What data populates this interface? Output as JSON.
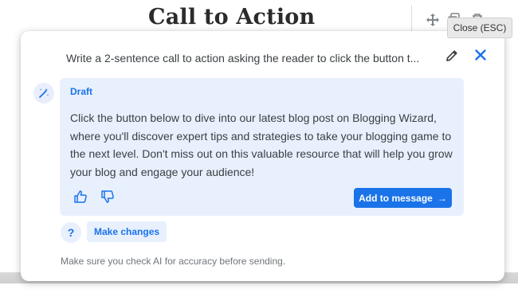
{
  "editor": {
    "title": "Call to Action",
    "toolbar_icons": [
      "move-icon",
      "copy-icon",
      "delete-icon"
    ]
  },
  "tooltip": {
    "text": "Close (ESC)"
  },
  "dialog": {
    "prompt": "Write a 2-sentence call to action asking the reader to click the button t...",
    "draft": {
      "label": "Draft",
      "body": "Click the button below to dive into our latest blog post on Blogging Wizard, where you'll discover expert tips and strategies to take your blogging game to the next level. Don't miss out on this valuable resource that will help you grow your blog and engage your audience!",
      "add_button": "Add to message",
      "add_button_arrow": "→"
    },
    "help_label": "?",
    "make_changes": "Make changes",
    "disclaimer": "Make sure you check AI for accuracy before sending."
  },
  "colors": {
    "accent": "#1a73e8",
    "card_bg": "#e8f0fe",
    "text": "#3c4043",
    "muted": "#70757a"
  }
}
